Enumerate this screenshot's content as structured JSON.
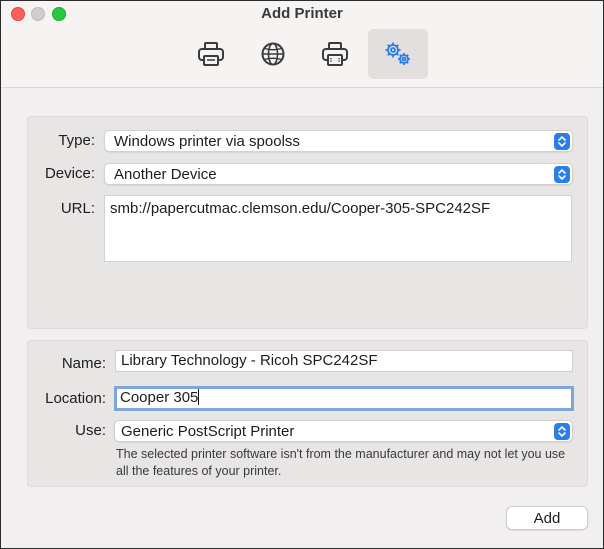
{
  "window": {
    "title": "Add Printer"
  },
  "toolbar": {
    "tabs": [
      {
        "icon": "printer-icon",
        "active": false
      },
      {
        "icon": "globe-icon",
        "active": false
      },
      {
        "icon": "fax-printer-icon",
        "active": false
      },
      {
        "icon": "gears-icon",
        "active": true
      }
    ]
  },
  "connection": {
    "type_label": "Type:",
    "type_value": "Windows printer via spoolss",
    "device_label": "Device:",
    "device_value": "Another Device",
    "url_label": "URL:",
    "url_value": "smb://papercutmac.clemson.edu/Cooper-305-SPC242SF"
  },
  "details": {
    "name_label": "Name:",
    "name_value": "Library Technology - Ricoh SPC242SF",
    "location_label": "Location:",
    "location_value": "Cooper 305",
    "use_label": "Use:",
    "use_value": "Generic PostScript Printer",
    "note": "The selected printer software isn't from the manufacturer and may not let you use all the features of your printer."
  },
  "actions": {
    "add_label": "Add"
  },
  "colors": {
    "accent": "#2b7de9",
    "focus_ring": "#7ea6dc",
    "close": "#ff5f57",
    "zoom": "#28c840"
  }
}
